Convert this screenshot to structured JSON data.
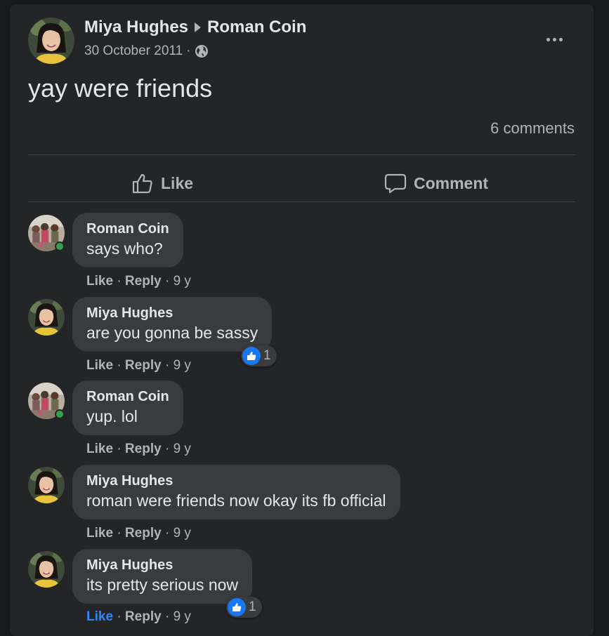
{
  "post": {
    "author": "Miya Hughes",
    "target": "Roman Coin",
    "date": "30 October 2011",
    "separator": "·",
    "text": "yay were friends",
    "comments_count": "6 comments"
  },
  "actions": {
    "like_label": "Like",
    "comment_label": "Comment"
  },
  "comments": [
    {
      "author": "Roman Coin",
      "text": "says who?",
      "like": "Like",
      "reply": "Reply",
      "sep": "·",
      "time": "9 y"
    },
    {
      "author": "Miya Hughes",
      "text": "are you gonna be sassy",
      "like": "Like",
      "reply": "Reply",
      "sep": "·",
      "time": "9 y",
      "reactions": "1"
    },
    {
      "author": "Roman Coin",
      "text": "yup. lol",
      "like": "Like",
      "reply": "Reply",
      "sep": "·",
      "time": "9 y"
    },
    {
      "author": "Miya Hughes",
      "text": "roman were friends now okay its fb official",
      "like": "Like",
      "reply": "Reply",
      "sep": "·",
      "time": "9 y"
    },
    {
      "author": "Miya Hughes",
      "text": "its pretty serious now",
      "like": "Like",
      "reply": "Reply",
      "sep": "·",
      "time": "9 y",
      "reactions": "1",
      "liked": true
    }
  ],
  "colors": {
    "background": "#18191a",
    "card": "#242526",
    "bubble": "#3a3b3c",
    "accent": "#2d88ff",
    "online": "#31a24c"
  },
  "icons": [
    "globe-icon",
    "more-options-icon",
    "thumbs-up-icon",
    "comment-icon",
    "like-reaction-icon",
    "online-status-dot"
  ]
}
